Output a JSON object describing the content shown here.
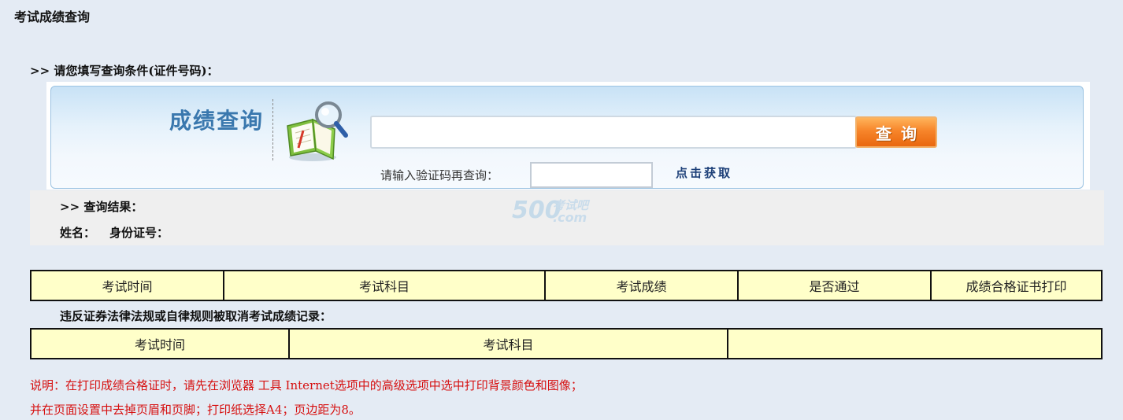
{
  "page_title": "考试成绩查询",
  "condition_heading": ">> 请您填写查询条件(证件号码)：",
  "search_panel": {
    "title": "成绩查询",
    "query_input_value": "",
    "query_button_label": "查询",
    "captcha_label": "请输入验证码再查询：",
    "captcha_input_value": "",
    "captcha_link_label": "点击获取"
  },
  "result": {
    "heading": ">> 查询结果：",
    "name_label": "姓名：",
    "id_label": "身份证号："
  },
  "watermark": {
    "number": "500",
    "cn": "考试吧",
    "domain": ".com"
  },
  "score_table": {
    "headers": [
      "考试时间",
      "考试科目",
      "考试成绩",
      "是否通过",
      "成绩合格证书打印"
    ]
  },
  "violation_heading": "违反证券法律法规或自律规则被取消考试成绩记录：",
  "violation_table": {
    "headers": [
      "考试时间",
      "考试科目",
      ""
    ]
  },
  "notes": [
    "说明：在打印成绩合格证时，请先在浏览器 工具 Internet选项中的高级选项中选中打印背景颜色和图像；",
    "并在页面设置中去掉页眉和页脚；打印纸选择A4；页边距为8。"
  ],
  "colors": {
    "page_bg": "#e4ebf4",
    "table_bg": "#ffffc9",
    "note_text": "#d61010",
    "panel_title": "#3a78ae",
    "button": "#f7852a"
  }
}
